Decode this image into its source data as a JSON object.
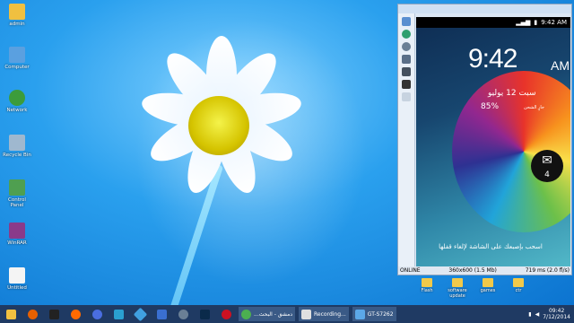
{
  "desktop": {
    "icons": [
      {
        "label": "admin",
        "icon": "folder-user-icon",
        "color": "#f0c040"
      },
      {
        "label": "Computer",
        "icon": "computer-icon",
        "color": "#5aa0e0"
      },
      {
        "label": "Network",
        "icon": "network-globe-icon",
        "color": "#3c9c3c"
      },
      {
        "label": "Recycle Bin",
        "icon": "recycle-bin-icon",
        "color": "#9fb8cf"
      },
      {
        "label": "Control Panel",
        "icon": "control-panel-icon",
        "color": "#4f9f50"
      },
      {
        "label": "WinRAR",
        "icon": "winrar-archive-icon",
        "color": "#8a3a8a"
      },
      {
        "label": "Untitled",
        "icon": "document-icon",
        "color": "#f4f4f4"
      }
    ],
    "bottom_icons": [
      {
        "label": "Flash",
        "icon": "folder-icon"
      },
      {
        "label": "software update",
        "icon": "folder-icon"
      },
      {
        "label": "games",
        "icon": "folder-icon"
      },
      {
        "label": "ctr",
        "icon": "folder-icon"
      }
    ]
  },
  "phone_window": {
    "title": "GT-S7262",
    "status_time": "9:42 AM",
    "clock_time": "9:42",
    "clock_ampm": "AM",
    "date_text": "سبت 12 يوليو",
    "battery_text": "85%",
    "charging_text": "جارٍ الشحن",
    "mail_count": "4",
    "unlock_text": "اسحب بإصبعك على الشاشة لإلغاء قفلها",
    "status_left": "ONLINE",
    "status_middle": "360x600 (1.5 Mb)",
    "status_right": "719 ms (2.0 fl/s)"
  },
  "taskbar": {
    "apps": [
      {
        "name": "file-explorer",
        "icon": "folder-icon",
        "color": "#f0c040"
      },
      {
        "name": "firefox",
        "icon": "firefox-icon",
        "color": "#e66000"
      },
      {
        "name": "cmd",
        "icon": "monitor-icon",
        "color": "#222222"
      },
      {
        "name": "media",
        "icon": "media-player-icon",
        "color": "#ff6a00"
      },
      {
        "name": "browser",
        "icon": "browser-icon",
        "color": "#4a6ee0"
      },
      {
        "name": "messenger",
        "icon": "messenger-icon",
        "color": "#2aa0d0"
      },
      {
        "name": "app-diamond",
        "icon": "diamond-icon",
        "color": "#40a0e0"
      },
      {
        "name": "grid",
        "icon": "grid-icon",
        "color": "#3a6fd0"
      },
      {
        "name": "settings",
        "icon": "gear-icon",
        "color": "#6a7f95"
      },
      {
        "name": "photoshop",
        "icon": "photoshop-icon",
        "color": "#0a2a4a"
      },
      {
        "name": "opera",
        "icon": "opera-icon",
        "color": "#cc1122"
      }
    ],
    "windows": [
      {
        "label": "...دمشق - البحث",
        "icon": "chrome-icon",
        "color": "#4caf50"
      },
      {
        "label": "Recording...",
        "icon": "recording-icon",
        "color": "#e0e0e0"
      },
      {
        "label": "GT-S7262",
        "icon": "phone-icon",
        "color": "#5ba8e8"
      }
    ],
    "tray_time": "09:42",
    "tray_date": "7/12/2014"
  }
}
